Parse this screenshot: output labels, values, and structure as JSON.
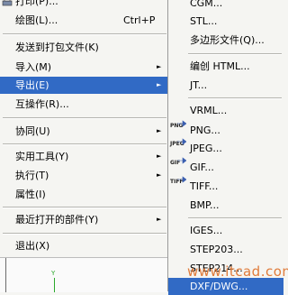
{
  "main_menu": {
    "items": [
      {
        "label": "打印(P)..."
      },
      {
        "label": "绘图(L)...",
        "shortcut": "Ctrl+P"
      },
      {
        "label": "发送到打包文件(K)"
      },
      {
        "label": "导入(M)"
      },
      {
        "label": "导出(E)"
      },
      {
        "label": "互操作(R)..."
      },
      {
        "label": "协同(U)"
      },
      {
        "label": "实用工具(Y)"
      },
      {
        "label": "执行(T)"
      },
      {
        "label": "属性(I)"
      },
      {
        "label": "最近打开的部件(Y)"
      },
      {
        "label": "退出(X)"
      }
    ],
    "submenu_arrow": "►"
  },
  "export_submenu": {
    "items": [
      {
        "label": "CGM..."
      },
      {
        "label": "STL..."
      },
      {
        "label": "多边形文件(Q)..."
      },
      {
        "label": "编创 HTML..."
      },
      {
        "label": "JT..."
      },
      {
        "label": "VRML..."
      },
      {
        "label": "PNG...",
        "badge": "PNG"
      },
      {
        "label": "JPEG...",
        "badge": "JPEG"
      },
      {
        "label": "GIF...",
        "badge": "GIF"
      },
      {
        "label": "TIFF...",
        "badge": "TIFF"
      },
      {
        "label": "BMP..."
      },
      {
        "label": "IGES..."
      },
      {
        "label": "STEP203..."
      },
      {
        "label": "STEP214..."
      },
      {
        "label": "DXF/DWG..."
      }
    ]
  },
  "viewport": {
    "axis_label": "Y"
  },
  "watermark": "www.itcad.com",
  "colors": {
    "highlight": "#316ac5",
    "menu_bg": "#f5f5f2",
    "axis": "#2aa82a",
    "watermark": "#e07b3a"
  }
}
